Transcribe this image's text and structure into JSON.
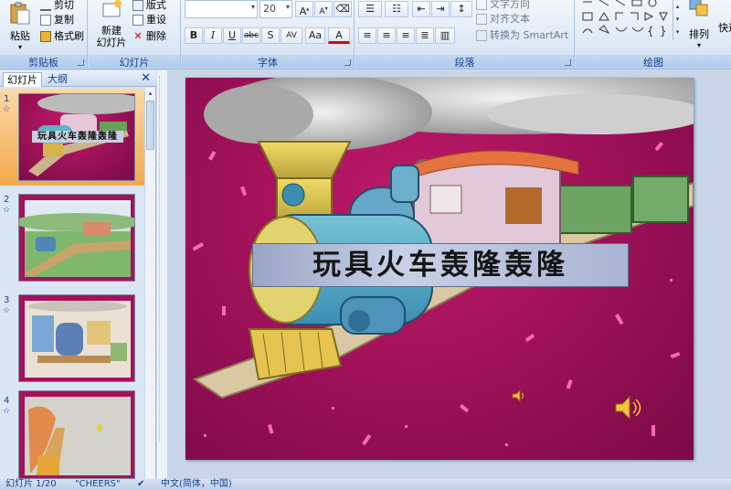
{
  "ribbon": {
    "clipboard": {
      "label": "剪贴板",
      "paste": "粘贴",
      "cut": "剪切",
      "copy": "复制",
      "format_painter": "格式刷"
    },
    "slides": {
      "label": "幻灯片",
      "new_slide": "新建\n幻灯片",
      "layout": "版式",
      "reset": "重设",
      "delete": "删除"
    },
    "font": {
      "label": "字体",
      "size": "20",
      "bold": "B",
      "italic": "I",
      "underline": "U",
      "strike": "abc",
      "shadow": "S",
      "spacing": "AV",
      "case": "Aa",
      "color": "A"
    },
    "paragraph": {
      "label": "段落",
      "text_direction": "文字方向",
      "align_text": "对齐文本",
      "smartart": "转换为 SmartArt"
    },
    "drawing": {
      "label": "绘图",
      "arrange": "排列",
      "quick_styles": "快速"
    }
  },
  "panel": {
    "tab_slides": "幻灯片",
    "tab_outline": "大纲",
    "close": "✕"
  },
  "thumbs": [
    {
      "num": "1",
      "star": "☆",
      "title": "玩具火车轰隆轰隆"
    },
    {
      "num": "2",
      "star": "☆"
    },
    {
      "num": "3",
      "star": "☆"
    },
    {
      "num": "4",
      "star": "☆"
    }
  ],
  "slide": {
    "title": "玩具火车轰隆轰隆"
  },
  "status": {
    "slide_count": "幻灯片 1/20",
    "theme": "\"CHEERS\"",
    "language": "中文(简体，中国)"
  },
  "colors": {
    "accent": "#15428b",
    "slide_bg": "#a1115a",
    "selected_thumb": "#f6a94c"
  }
}
